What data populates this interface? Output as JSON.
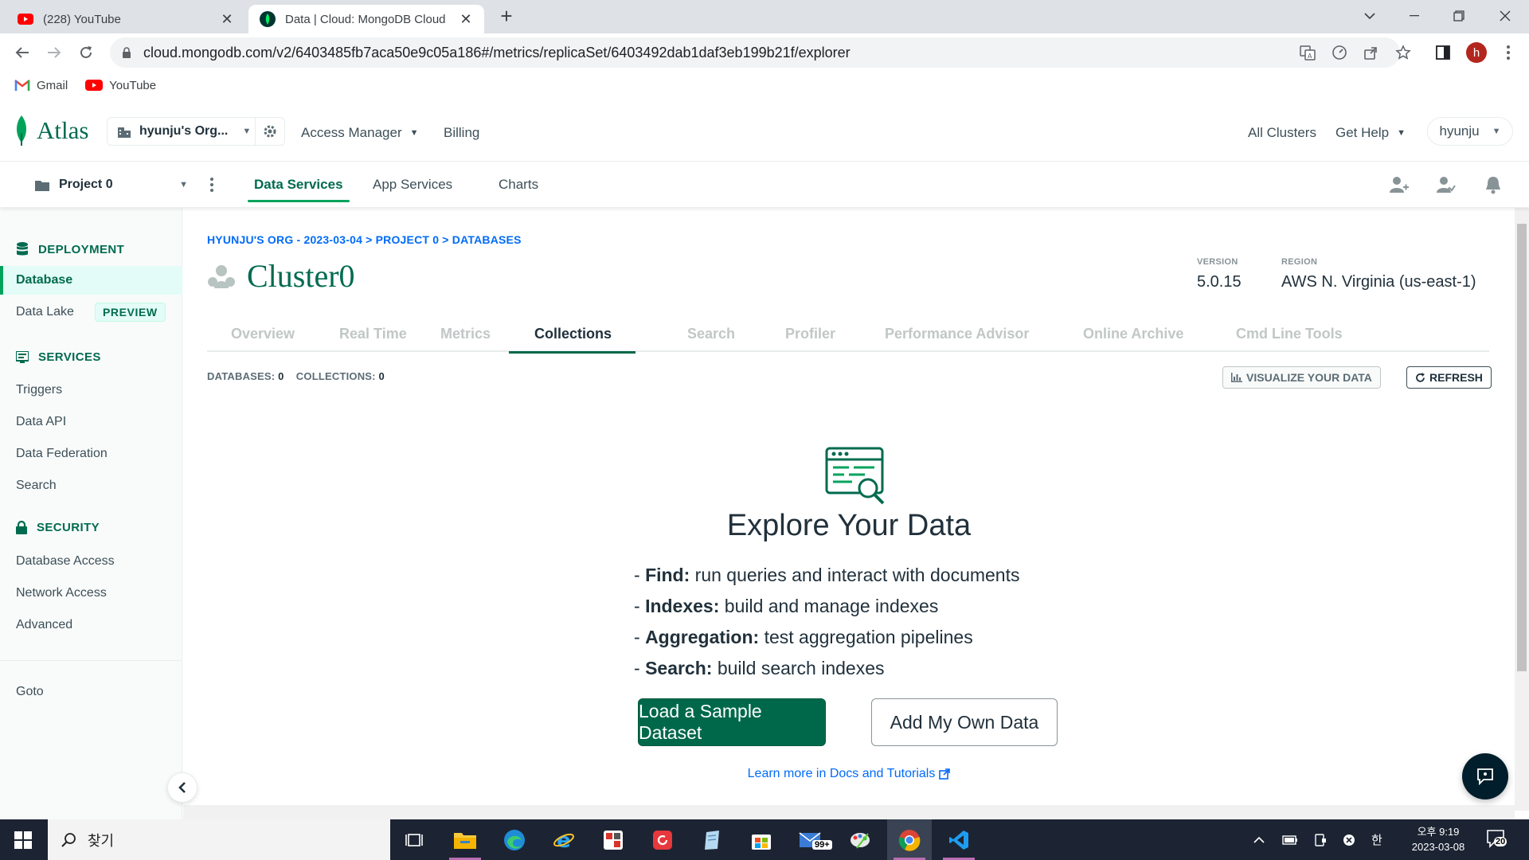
{
  "browser": {
    "tabs": [
      {
        "title": "(228) YouTube",
        "close": "✕"
      },
      {
        "title": "Data | Cloud: MongoDB Cloud",
        "close": "✕"
      }
    ],
    "new_tab": "+",
    "url": "cloud.mongodb.com/v2/6403485fb7aca50e9c05a186#/metrics/replicaSet/6403492dab1daf3eb199b21f/explorer",
    "profile_initial": "h",
    "bookmarks": [
      "Gmail",
      "YouTube"
    ]
  },
  "atlas": {
    "logo_text": "Atlas",
    "org_name": "hyunju's Org...",
    "nav": {
      "access_manager": "Access Manager",
      "billing": "Billing",
      "all_clusters": "All Clusters",
      "get_help": "Get Help",
      "user": "hyunju"
    },
    "project_name": "Project 0",
    "service_tabs": [
      "Data Services",
      "App Services",
      "Charts"
    ]
  },
  "sidebar": {
    "deployment_title": "DEPLOYMENT",
    "database": "Database",
    "data_lake": "Data Lake",
    "preview_badge": "PREVIEW",
    "services_title": "SERVICES",
    "services_items": [
      "Triggers",
      "Data API",
      "Data Federation",
      "Search"
    ],
    "security_title": "SECURITY",
    "security_items": [
      "Database Access",
      "Network Access",
      "Advanced"
    ],
    "goto": "Goto"
  },
  "main": {
    "breadcrumb": "HYUNJU'S ORG - 2023-03-04 > PROJECT 0 > DATABASES",
    "cluster_name": "Cluster0",
    "version_label": "VERSION",
    "version_value": "5.0.15",
    "region_label": "REGION",
    "region_value": "AWS N. Virginia (us-east-1)",
    "tabs": [
      "Overview",
      "Real Time",
      "Metrics",
      "Collections",
      "Search",
      "Profiler",
      "Performance Advisor",
      "Online Archive",
      "Cmd Line Tools"
    ],
    "databases_label": "DATABASES:",
    "databases_count": "0",
    "collections_label": "COLLECTIONS:",
    "collections_count": "0",
    "visualize_label": "VISUALIZE YOUR DATA",
    "refresh_label": "REFRESH",
    "explore_title": "Explore Your Data",
    "features": [
      {
        "name": "Find:",
        "desc": "run queries and interact with documents"
      },
      {
        "name": "Indexes:",
        "desc": "build and manage indexes"
      },
      {
        "name": "Aggregation:",
        "desc": "test aggregation pipelines"
      },
      {
        "name": "Search:",
        "desc": "build search indexes"
      }
    ],
    "load_sample_label": "Load a Sample Dataset",
    "add_own_label": "Add My Own Data",
    "learn_more": "Learn more in Docs and Tutorials"
  },
  "taskbar": {
    "search_placeholder": "찾기",
    "mail_badge": "99+",
    "ime": "한",
    "time": "오후 9:19",
    "date": "2023-03-08",
    "notifications": "20"
  },
  "colors": {
    "accent": "#00684a",
    "brand_green": "#016b4f",
    "link": "#016bf8"
  }
}
